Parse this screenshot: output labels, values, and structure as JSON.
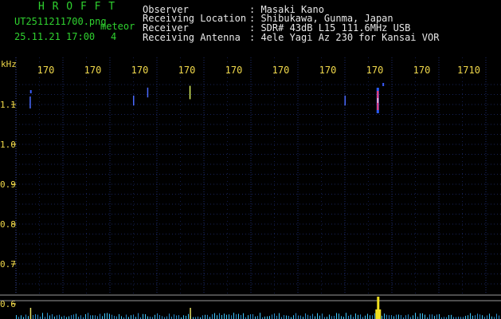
{
  "app": {
    "title": "H R O F F T",
    "filename": "UT2511211700.png",
    "meteor_label": "meteor",
    "datetime": "25.11.21 17:00",
    "meteor_count": "4"
  },
  "header": {
    "observer_label": "Observer",
    "observer_value": ": Masaki Kano",
    "location_label": "Receiving Location",
    "location_value": ": Shibukawa, Gunma, Japan",
    "receiver_label": "Receiver",
    "receiver_value": ": SDR# 43dB L15 111.6MHz USB",
    "antenna_label": "Receiving Antenna",
    "antenna_value": ": 4ele Yagi Az 230 for Kansai VOR"
  },
  "chart_data": {
    "type": "heatmap",
    "ylabel": "kHz",
    "y_ticks": [
      "1.1",
      "1.0",
      "0.9",
      "0.8",
      "0.7",
      "0.6"
    ],
    "x_ticks": [
      "170",
      "170",
      "170",
      "170",
      "170",
      "170",
      "170",
      "170",
      "170",
      "1710"
    ],
    "grid": true,
    "background": "#000000",
    "grid_color": "#1c2a6a",
    "signal_color": "#ffffff",
    "detections": [
      {
        "time_min": 0.3,
        "freq_khz": 1.105,
        "intensity": 0.5
      },
      {
        "time_min": 2.5,
        "freq_khz": 1.11,
        "intensity": 0.35
      },
      {
        "time_min": 2.8,
        "freq_khz": 1.13,
        "intensity": 0.35
      },
      {
        "time_min": 3.7,
        "freq_khz": 1.13,
        "intensity": 0.6
      },
      {
        "time_min": 7.0,
        "freq_khz": 1.11,
        "intensity": 0.35
      },
      {
        "time_min": 7.7,
        "freq_khz": 1.11,
        "intensity": 1.0
      }
    ],
    "spectrum_peak_time_min": 7.7
  }
}
